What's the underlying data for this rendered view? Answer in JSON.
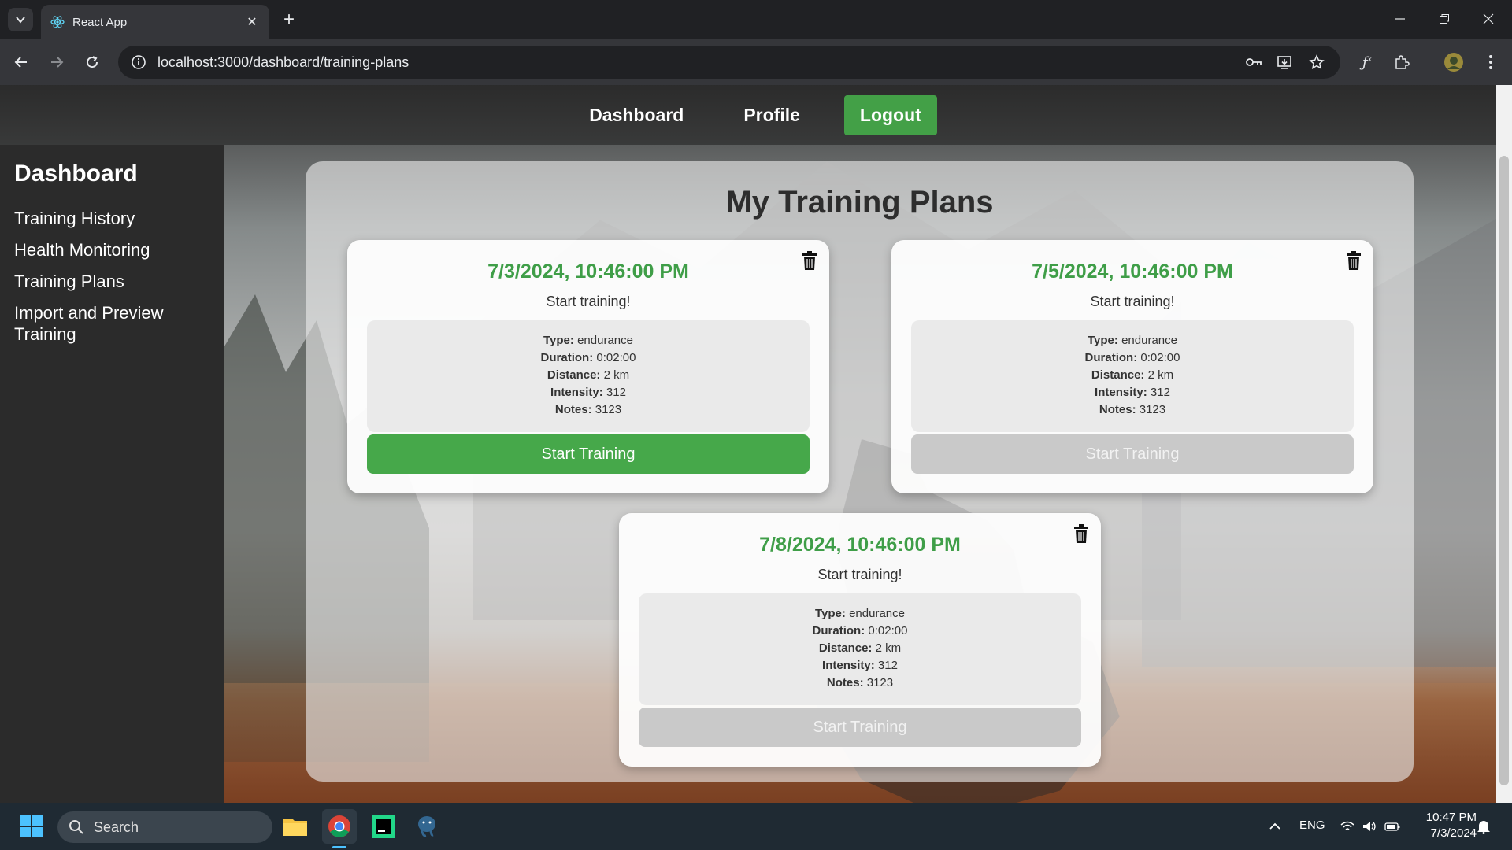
{
  "browser": {
    "tab_title": "React App",
    "tab_close": "✕",
    "new_tab": "+",
    "url": "localhost:3000/dashboard/training-plans"
  },
  "topnav": {
    "dashboard": "Dashboard",
    "profile": "Profile",
    "logout": "Logout"
  },
  "sidebar": {
    "title": "Dashboard",
    "items": [
      {
        "label": "Training History"
      },
      {
        "label": "Health Monitoring"
      },
      {
        "label": "Training Plans"
      },
      {
        "label": "Import and Preview Training"
      }
    ]
  },
  "main": {
    "title": "My Training Plans",
    "field_labels": {
      "type": "Type:",
      "duration": "Duration:",
      "distance": "Distance:",
      "intensity": "Intensity:",
      "notes": "Notes:"
    },
    "cards": [
      {
        "date": "7/3/2024, 10:46:00 PM",
        "subtitle": "Start training!",
        "type": "endurance",
        "duration": "0:02:00",
        "distance": "2 km",
        "intensity": "312",
        "notes": "3123",
        "button": "Start Training",
        "enabled": true
      },
      {
        "date": "7/5/2024, 10:46:00 PM",
        "subtitle": "Start training!",
        "type": "endurance",
        "duration": "0:02:00",
        "distance": "2 km",
        "intensity": "312",
        "notes": "3123",
        "button": "Start Training",
        "enabled": false
      },
      {
        "date": "7/8/2024, 10:46:00 PM",
        "subtitle": "Start training!",
        "type": "endurance",
        "duration": "0:02:00",
        "distance": "2 km",
        "intensity": "312",
        "notes": "3123",
        "button": "Start Training",
        "enabled": false
      }
    ]
  },
  "taskbar": {
    "search": "Search",
    "lang": "ENG",
    "time": "10:47 PM",
    "date": "7/3/2024"
  },
  "colors": {
    "accent_green": "#43a047",
    "date_green": "#3f9e48",
    "disabled_gray": "#c9c9c9"
  },
  "icons": [
    "chevron-down-icon",
    "react-icon",
    "back-icon",
    "forward-icon",
    "reload-icon",
    "info-icon",
    "key-icon",
    "install-icon",
    "star-icon",
    "function-icon",
    "extensions-icon",
    "profile-avatar-icon",
    "more-icon",
    "trash-icon",
    "windows-start-icon",
    "search-icon",
    "file-explorer-icon",
    "chrome-icon",
    "pycharm-icon",
    "postgres-icon",
    "chevron-up-icon",
    "wifi-icon",
    "volume-icon",
    "battery-icon",
    "bell-icon"
  ]
}
